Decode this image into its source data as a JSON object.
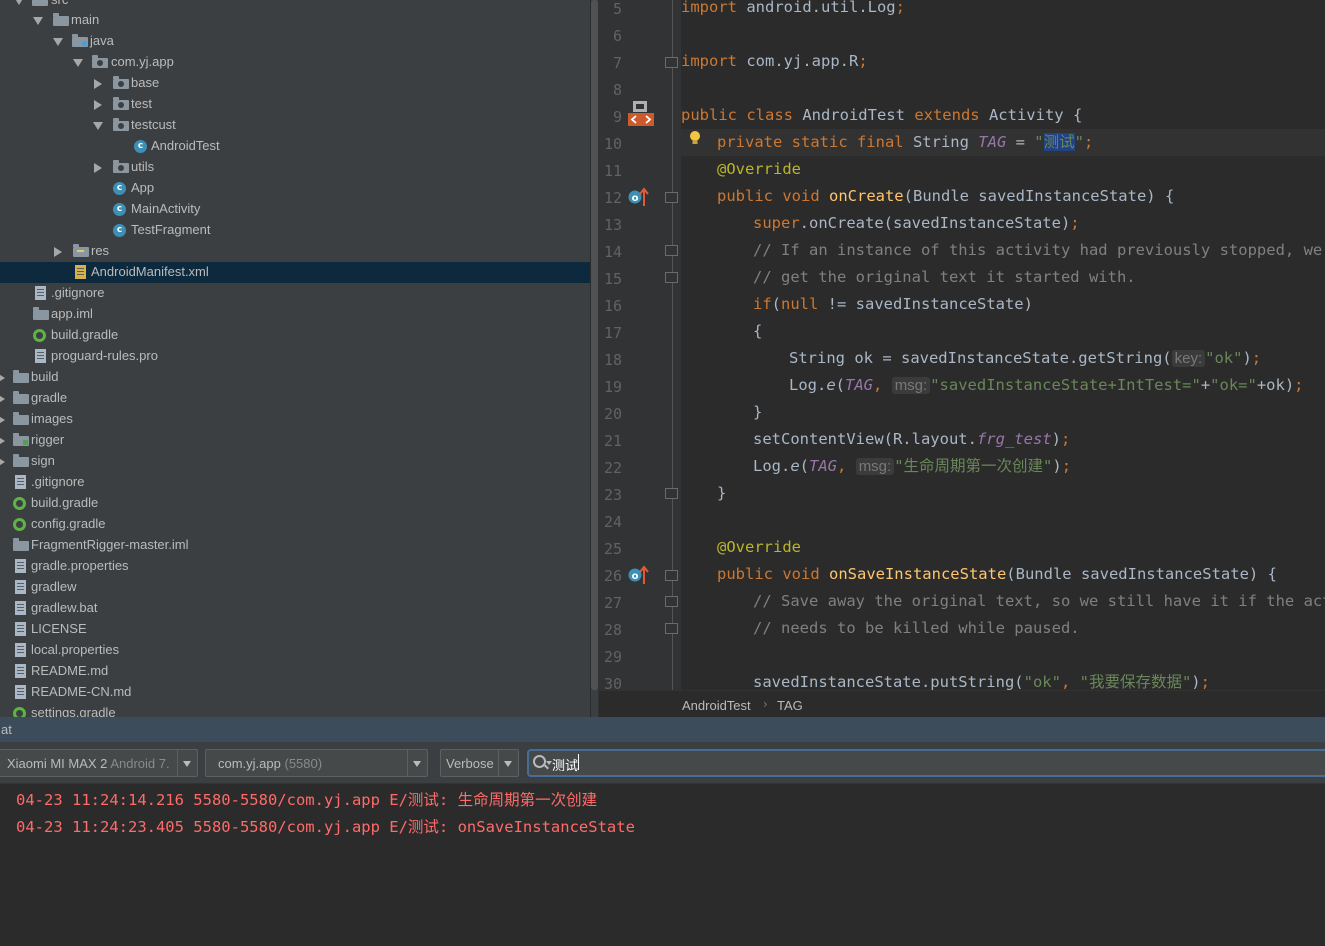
{
  "tree": {
    "rows": [
      {
        "label": "src",
        "indent": 1,
        "arrow": "open",
        "icon": "folder"
      },
      {
        "label": "main",
        "indent": 2,
        "arrow": "open",
        "icon": "folder"
      },
      {
        "label": "java",
        "indent": 3,
        "arrow": "open",
        "icon": "folder-src"
      },
      {
        "label": "com.yj.app",
        "indent": 4,
        "arrow": "open",
        "icon": "package"
      },
      {
        "label": "base",
        "indent": 5,
        "arrow": "closed",
        "icon": "package"
      },
      {
        "label": "test",
        "indent": 5,
        "arrow": "closed",
        "icon": "package"
      },
      {
        "label": "testcust",
        "indent": 5,
        "arrow": "open",
        "icon": "package"
      },
      {
        "label": "AndroidTest",
        "indent": 6,
        "arrow": "",
        "icon": "class"
      },
      {
        "label": "utils",
        "indent": 5,
        "arrow": "closed",
        "icon": "package"
      },
      {
        "label": "App",
        "indent": 5,
        "arrow": "",
        "icon": "class"
      },
      {
        "label": "MainActivity",
        "indent": 5,
        "arrow": "",
        "icon": "class"
      },
      {
        "label": "TestFragment",
        "indent": 5,
        "arrow": "",
        "icon": "class"
      },
      {
        "label": "res",
        "indent": 3,
        "arrow": "closed",
        "icon": "folder-res"
      },
      {
        "label": "AndroidManifest.xml",
        "indent": 3,
        "arrow": "",
        "icon": "xml-file",
        "selected": true
      },
      {
        "label": ".gitignore",
        "indent": 1,
        "arrow": "",
        "icon": "file"
      },
      {
        "label": "app.iml",
        "indent": 1,
        "arrow": "",
        "icon": "folder"
      },
      {
        "label": "build.gradle",
        "indent": 1,
        "arrow": "",
        "icon": "gradle"
      },
      {
        "label": "proguard-rules.pro",
        "indent": 1,
        "arrow": "",
        "icon": "file"
      },
      {
        "label": "build",
        "indent": 0,
        "arrow": "closed",
        "icon": "folder"
      },
      {
        "label": "gradle",
        "indent": 0,
        "arrow": "closed",
        "icon": "folder"
      },
      {
        "label": "images",
        "indent": 0,
        "arrow": "closed",
        "icon": "folder"
      },
      {
        "label": "rigger",
        "indent": 0,
        "arrow": "closed",
        "icon": "folder-module"
      },
      {
        "label": "sign",
        "indent": 0,
        "arrow": "closed",
        "icon": "folder"
      },
      {
        "label": ".gitignore",
        "indent": 0,
        "arrow": "",
        "icon": "file"
      },
      {
        "label": "build.gradle",
        "indent": 0,
        "arrow": "",
        "icon": "gradle"
      },
      {
        "label": "config.gradle",
        "indent": 0,
        "arrow": "",
        "icon": "gradle"
      },
      {
        "label": "FragmentRigger-master.iml",
        "indent": 0,
        "arrow": "",
        "icon": "folder"
      },
      {
        "label": "gradle.properties",
        "indent": 0,
        "arrow": "",
        "icon": "file"
      },
      {
        "label": "gradlew",
        "indent": 0,
        "arrow": "",
        "icon": "file"
      },
      {
        "label": "gradlew.bat",
        "indent": 0,
        "arrow": "",
        "icon": "file"
      },
      {
        "label": "LICENSE",
        "indent": 0,
        "arrow": "",
        "icon": "file"
      },
      {
        "label": "local.properties",
        "indent": 0,
        "arrow": "",
        "icon": "file"
      },
      {
        "label": "README.md",
        "indent": 0,
        "arrow": "",
        "icon": "file"
      },
      {
        "label": "README-CN.md",
        "indent": 0,
        "arrow": "",
        "icon": "file"
      },
      {
        "label": "settings.gradle",
        "indent": 0,
        "arrow": "",
        "icon": "gradle"
      }
    ]
  },
  "editor": {
    "line_numbers": [
      "5",
      "6",
      "7",
      "8",
      "9",
      "10",
      "11",
      "12",
      "13",
      "14",
      "15",
      "16",
      "17",
      "18",
      "19",
      "20",
      "21",
      "22",
      "23",
      "24",
      "25",
      "26",
      "27",
      "28",
      "29",
      "30"
    ],
    "code": {
      "l5_kw": "import",
      "l5_rest": " android.util.Log",
      "l5_semi": ";",
      "l7_kw": "import",
      "l7_rest": " com.yj.app.R",
      "l7_semi": ";",
      "l9_kw1": "public class",
      "l9_name": " AndroidTest ",
      "l9_kw2": "extends",
      "l9_rest": " Activity {",
      "l10_kw": "private static final",
      "l10_type": " String ",
      "l10_field": "TAG",
      "l10_eq": " = ",
      "l10_q1": "\"",
      "l10_val": "测试",
      "l10_q2": "\"",
      "l10_semi": ";",
      "l11_ann": "@Override",
      "l12_kw": "public void",
      "l12_fn": " onCreate",
      "l12_rest": "(Bundle savedInstanceState) {",
      "l13_kw": "super",
      "l13_rest": ".onCreate(savedInstanceState)",
      "l13_semi": ";",
      "l14_cm": "// If an instance of this activity had previously stopped, we can",
      "l15_cm": "// get the original text it started with.",
      "l16_kw1": "if",
      "l16_p": "(",
      "l16_kw2": "null",
      "l16_rest": " != savedInstanceState)",
      "l17": "{",
      "l18_a": "String ok = savedInstanceState.getString(",
      "l18_hint": "key:",
      "l18_str": "\"ok\"",
      "l18_end": ")",
      "l18_semi": ";",
      "l19_a": "Log.",
      "l19_e": "e",
      "l19_p": "(",
      "l19_tag": "TAG",
      "l19_c": ", ",
      "l19_hint": "msg:",
      "l19_str": "\"savedInstanceState+IntTest=\"",
      "l19_plus": "+",
      "l19_str2": "\"ok=\"",
      "l19_end": "+ok)",
      "l19_semi": ";",
      "l20": "}",
      "l21_a": "setContentView(R.layout.",
      "l21_f": "frg_test",
      "l21_end": ")",
      "l21_semi": ";",
      "l22_a": "Log.",
      "l22_e": "e",
      "l22_p": "(",
      "l22_tag": "TAG",
      "l22_c": ", ",
      "l22_hint": "msg:",
      "l22_str": "\"生命周期第一次创建\"",
      "l22_end": ")",
      "l22_semi": ";",
      "l23": "}",
      "l25_ann": "@Override",
      "l26_kw": "public void",
      "l26_fn": " onSaveInstanceState",
      "l26_rest": "(Bundle savedInstanceState) {",
      "l27_cm": "// Save away the original text, so we still have it if the activity",
      "l28_cm": "// needs to be killed while paused.",
      "l30_a": "savedInstanceState.putString(",
      "l30_s1": "\"ok\"",
      "l30_c": ", ",
      "l30_s2": "\"我要保存数据\"",
      "l30_end": ")",
      "l30_semi": ";"
    },
    "breadcrumb": [
      "AndroidTest",
      "TAG"
    ]
  },
  "logcat": {
    "title": "at",
    "device": {
      "name": "Xiaomi MI MAX 2",
      "api": "Android 7."
    },
    "process": {
      "name": "com.yj.app",
      "pid": "(5580)"
    },
    "level": "Verbose",
    "search_value": "测试",
    "lines": [
      "04-23 11:24:14.216 5580-5580/com.yj.app E/测试: 生命周期第一次创建",
      "04-23 11:24:23.405 5580-5580/com.yj.app E/测试: onSaveInstanceState"
    ]
  },
  "colors": {
    "keyword": "#cc7832",
    "annotation": "#bbb529",
    "function": "#ffc66d",
    "string": "#6a8759",
    "comment": "#808080",
    "static_field": "#9876aa",
    "log_error": "#ff6b68",
    "selection": "#0d293e",
    "tool_title": "#3c4c5b"
  }
}
